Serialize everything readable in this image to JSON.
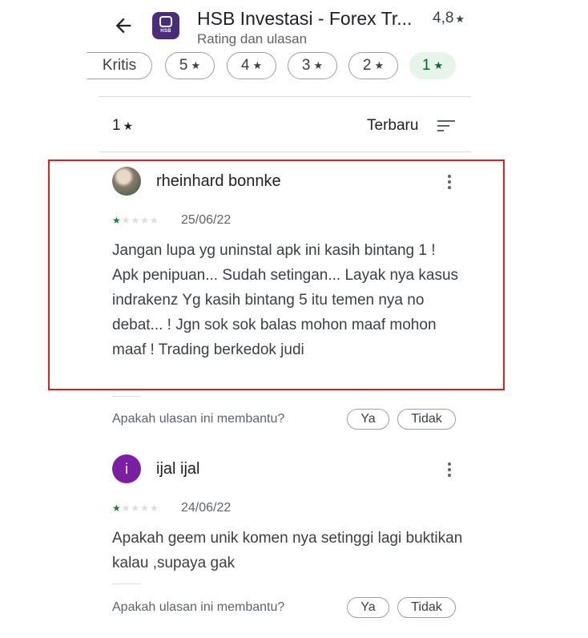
{
  "header": {
    "title": "HSB Investasi - Forex Tr...",
    "rating": "4,8",
    "subtitle": "Rating dan ulasan",
    "logo_text": "HSB"
  },
  "chips": [
    {
      "label": "Kritis",
      "star": ""
    },
    {
      "label": "5",
      "star": "★"
    },
    {
      "label": "4",
      "star": "★"
    },
    {
      "label": "3",
      "star": "★"
    },
    {
      "label": "2",
      "star": "★"
    },
    {
      "label": "1",
      "star": "★"
    }
  ],
  "filter": {
    "rating": "1",
    "star": "★",
    "sort": "Terbaru"
  },
  "reviews": [
    {
      "author": "rheinhard bonnke",
      "stars": 1,
      "date": "25/06/22",
      "text": "Jangan lupa yg uninstal apk ini kasih bintang 1 ! Apk penipuan... Sudah setingan... Layak nya kasus indrakenz Yg kasih bintang 5 itu temen nya no debat... ! Jgn sok sok balas mohon maaf mohon maaf ! Trading berkedok judi",
      "helpful_q": "Apakah ulasan ini membantu?",
      "yes": "Ya",
      "no": "Tidak"
    },
    {
      "author": "ijal ijal",
      "avatar_letter": "i",
      "stars": 1,
      "date": "24/06/22",
      "text": "Apakah geem unik komen nya setinggi lagi buktikan kalau ,supaya gak",
      "helpful_q": "Apakah ulasan ini membantu?",
      "yes": "Ya",
      "no": "Tidak"
    }
  ],
  "colors": {
    "accent_green": "#188038",
    "highlight_red": "#e01e1e",
    "avatar_purple": "#7b1fa2"
  }
}
